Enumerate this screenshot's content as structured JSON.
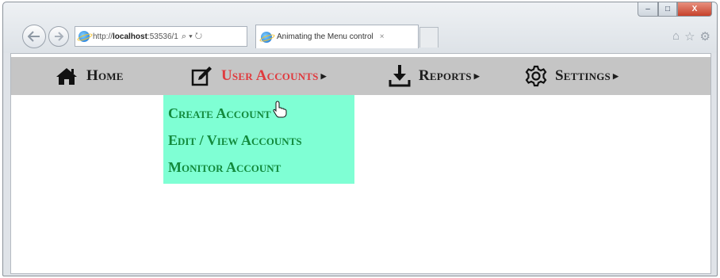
{
  "browser": {
    "address": {
      "prefix": "http://",
      "host": "localhost",
      "rest": ":53536/1",
      "tools": "⌕ ▾ ↻"
    },
    "tab": {
      "title": "Animating the Menu control",
      "close": "×"
    },
    "window_controls": {
      "min": "–",
      "max": "□",
      "close": "X"
    },
    "toolbar_icons": [
      "home-icon",
      "star-icon",
      "gear-icon"
    ]
  },
  "menu": {
    "items": [
      {
        "label": "Home",
        "icon": "home-icon",
        "has_submenu": false
      },
      {
        "label": "User Accounts",
        "icon": "edit-icon",
        "has_submenu": true,
        "active": true
      },
      {
        "label": "Reports",
        "icon": "download-icon",
        "has_submenu": true
      },
      {
        "label": "Settings",
        "icon": "gear-icon",
        "has_submenu": true
      }
    ],
    "arrow": "▶",
    "dropdown": [
      {
        "label": "Create Account"
      },
      {
        "label": "Edit / View Accounts"
      },
      {
        "label": "Monitor Account"
      }
    ],
    "colors": {
      "bar": "#c5c5c5",
      "active_text": "#e03a3e",
      "dropdown_bg": "#7fffd4",
      "dropdown_text": "#128a3c"
    }
  }
}
